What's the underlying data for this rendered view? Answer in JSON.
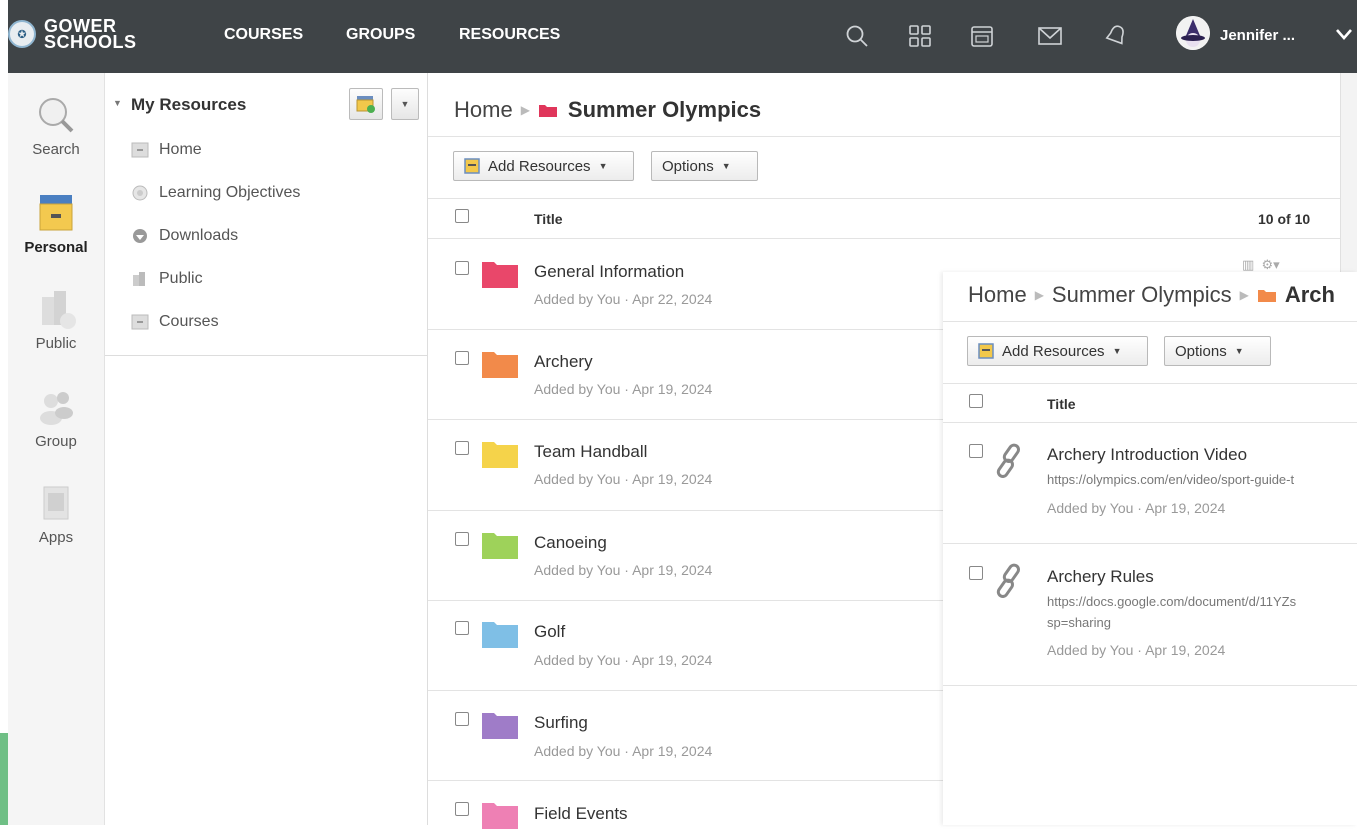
{
  "header": {
    "logo_line1": "GOWER",
    "logo_line2": "SCHOOLS",
    "nav": [
      "COURSES",
      "GROUPS",
      "RESOURCES"
    ],
    "user_name": "Jennifer ...",
    "icons": [
      "search-icon",
      "apps-grid-icon",
      "calendar-icon",
      "mail-icon",
      "notifications-icon",
      "chevron-down-icon"
    ]
  },
  "rail": {
    "items": [
      {
        "label": "Search",
        "icon": "search-icon"
      },
      {
        "label": "Personal",
        "icon": "personal-icon",
        "active": true
      },
      {
        "label": "Public",
        "icon": "public-icon"
      },
      {
        "label": "Group",
        "icon": "group-icon"
      },
      {
        "label": "Apps",
        "icon": "apps-icon"
      }
    ]
  },
  "tree": {
    "title": "My Resources",
    "items": [
      "Home",
      "Learning Objectives",
      "Downloads",
      "Public",
      "Courses"
    ]
  },
  "main": {
    "breadcrumb": {
      "home": "Home",
      "current": "Summer Olympics"
    },
    "add_resources": "Add Resources",
    "options": "Options",
    "col_title": "Title",
    "count": "10 of 10",
    "rows": [
      {
        "title": "General Information",
        "meta": "Added by You · Apr 22, 2024",
        "color": "#e9476a"
      },
      {
        "title": "Archery",
        "meta": "Added by You · Apr 19, 2024",
        "color": "#f28a4a"
      },
      {
        "title": "Team Handball",
        "meta": "Added by You · Apr 19, 2024",
        "color": "#f5d34a"
      },
      {
        "title": "Canoeing",
        "meta": "Added by You · Apr 19, 2024",
        "color": "#9ed25a"
      },
      {
        "title": "Golf",
        "meta": "Added by You · Apr 19, 2024",
        "color": "#7fbfe6"
      },
      {
        "title": "Surfing",
        "meta": "Added by You · Apr 19, 2024",
        "color": "#9f7cc8"
      },
      {
        "title": "Field Events",
        "meta": "",
        "color": "#ee80b4"
      }
    ]
  },
  "panel": {
    "breadcrumb": {
      "home": "Home",
      "mid": "Summer Olympics",
      "current": "Arch"
    },
    "add_resources": "Add Resources",
    "options": "Options",
    "col_title": "Title",
    "rows": [
      {
        "title": "Archery Introduction Video",
        "url": "https://olympics.com/en/video/sport-guide-t",
        "url2": "",
        "meta": "Added by You · Apr 19, 2024"
      },
      {
        "title": "Archery Rules",
        "url": "https://docs.google.com/document/d/11YZs",
        "url2": "sp=sharing",
        "meta": "Added by You · Apr 19, 2024"
      }
    ]
  },
  "colors": {
    "topbar": "#3f4447",
    "folder_current": "#e0365b",
    "folder_archery": "#f28a4a"
  }
}
